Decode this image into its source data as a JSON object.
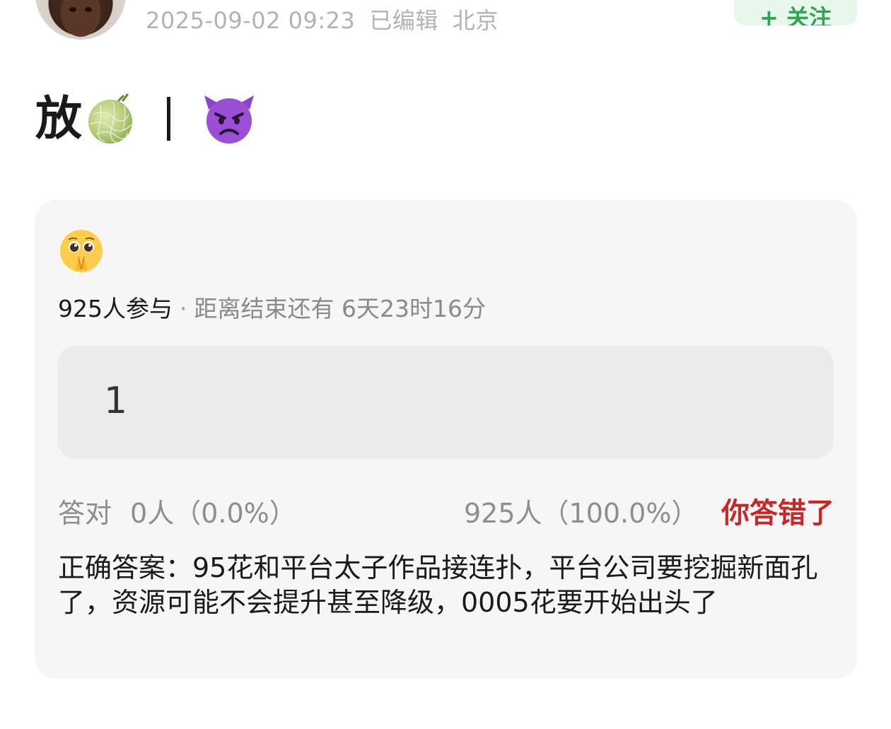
{
  "header": {
    "timestamp": "2025-09-02 09:23",
    "edited_label": "已编辑",
    "location": "北京",
    "follow_label": "+ 关注"
  },
  "post": {
    "title_char": "放",
    "icons": [
      "melon-icon",
      "devil-icon"
    ]
  },
  "quiz": {
    "icon": "pleading-face-icon",
    "participants": "925人参与",
    "remaining": "距离结束还有 6天23时16分",
    "option_text": "1",
    "correct_label": "答对",
    "correct_count": "0人（0.0%）",
    "wrong_count": "925人（100.0%）",
    "result_label": "你答错了",
    "answer": "正确答案：95花和平台太子作品接连扑，平台公司要挖掘新面孔了，资源可能不会提升甚至降级，0005花要开始出头了"
  },
  "colors": {
    "accent_green": "#2ea44f",
    "wrong_red": "#c62828",
    "card_bg": "#f6f6f6"
  }
}
